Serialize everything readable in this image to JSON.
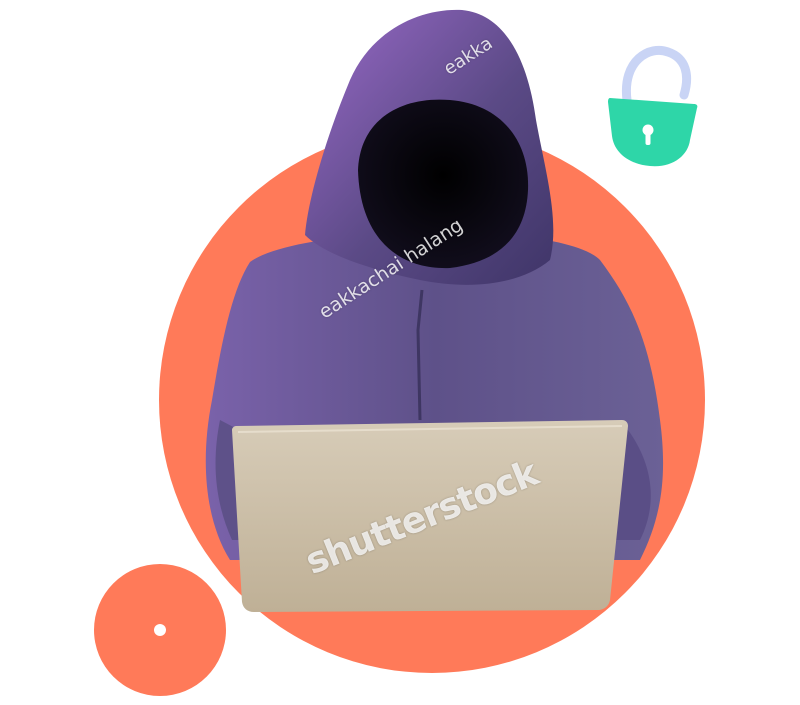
{
  "image": {
    "subject": "hooded figure at laptop",
    "colors": {
      "accent_circle": "#FF7A59",
      "hoodie": "#5B4A86",
      "hoodie_highlight": "#9A6AC9",
      "laptop": "#CDBFA8",
      "lock_body": "#2ED6A8",
      "lock_shackle": "#C9D4F5",
      "background": "#FFFFFF"
    },
    "icons": [
      "padlock-open-icon",
      "dot-icon"
    ],
    "watermarks": {
      "author": "eakkachai halang",
      "author_partial": "eakka",
      "brand": "shutterstock"
    }
  }
}
